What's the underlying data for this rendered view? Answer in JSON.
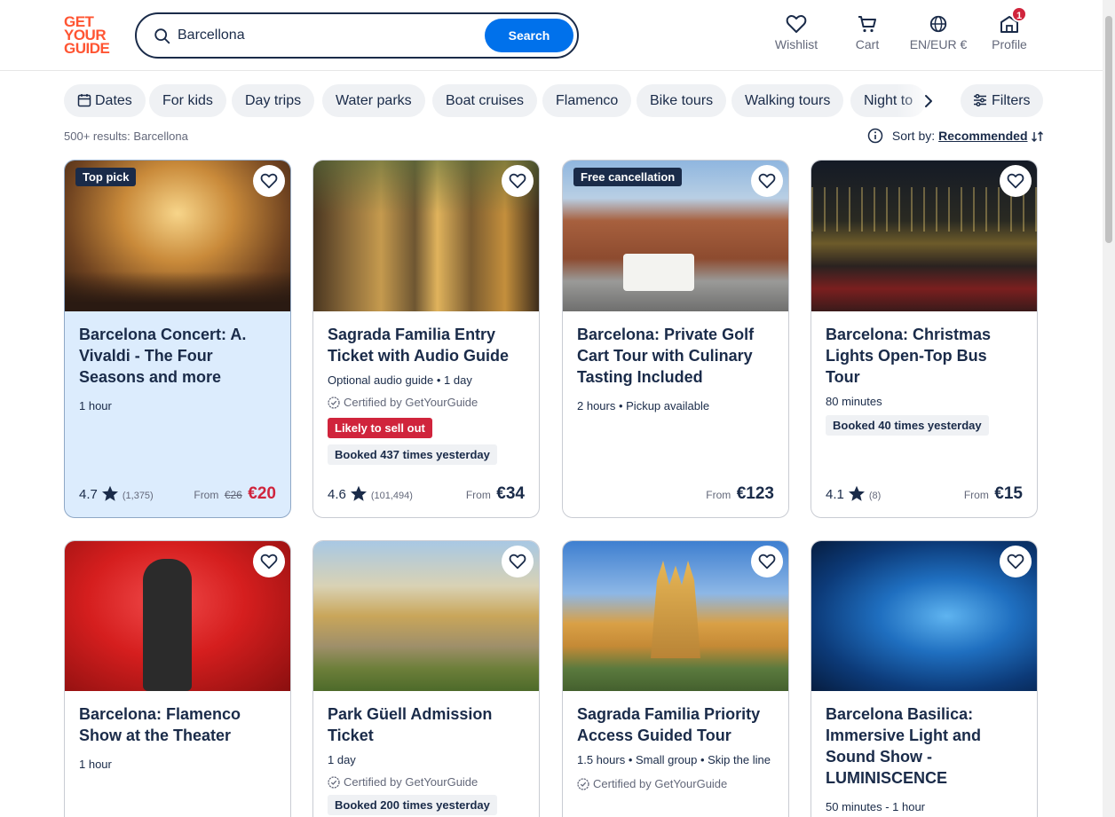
{
  "brand": {
    "line1": "GET",
    "line2": "YOUR",
    "line3": "GUIDE"
  },
  "search": {
    "value": "Barcellona",
    "button": "Search"
  },
  "nav": {
    "wishlist": "Wishlist",
    "cart": "Cart",
    "locale": "EN/EUR €",
    "profile": "Profile",
    "profile_badge": "1"
  },
  "chips": [
    "Dates",
    "For kids",
    "Day trips",
    "Water parks",
    "Boat cruises",
    "Flamenco",
    "Bike tours",
    "Walking tours",
    "Night to"
  ],
  "filters_label": "Filters",
  "results_text": "500+ results: Barcellona",
  "sort": {
    "label": "Sort by:",
    "value": "Recommended"
  },
  "cards": [
    {
      "ribbon": "Top pick",
      "title": "Barcelona Concert: A. Vivaldi - The Four Seasons and more",
      "meta": "1 hour",
      "rating": "4.7",
      "count": "(1,375)",
      "from": "From",
      "old_price": "€26",
      "price": "€20"
    },
    {
      "title": "Sagrada Familia Entry Ticket with Audio Guide",
      "meta": "Optional audio guide • 1 day",
      "cert": "Certified by GetYourGuide",
      "sell": "Likely to sell out",
      "booked": "Booked 437 times yesterday",
      "rating": "4.6",
      "count": "(101,494)",
      "from": "From",
      "price": "€34"
    },
    {
      "ribbon": "Free cancellation",
      "title": "Barcelona: Private Golf Cart Tour with Culinary Tasting Included",
      "meta": "2 hours • Pickup available",
      "from": "From",
      "price": "€123"
    },
    {
      "title": "Barcelona: Christmas Lights Open-Top Bus Tour",
      "meta": "80 minutes",
      "booked": "Booked 40 times yesterday",
      "rating": "4.1",
      "count": "(8)",
      "from": "From",
      "price": "€15"
    },
    {
      "title": "Barcelona: Flamenco Show at the Theater",
      "meta": "1 hour"
    },
    {
      "title": "Park Güell Admission Ticket",
      "meta": "1 day",
      "cert": "Certified by GetYourGuide",
      "booked": "Booked 200 times yesterday"
    },
    {
      "title": "Sagrada Familia Priority Access Guided Tour",
      "meta": "1.5 hours • Small group • Skip the line",
      "cert": "Certified by GetYourGuide"
    },
    {
      "title": "Barcelona Basilica: Immersive Light and Sound Show - LUMINISCENCE",
      "meta": "50 minutes - 1 hour"
    }
  ]
}
